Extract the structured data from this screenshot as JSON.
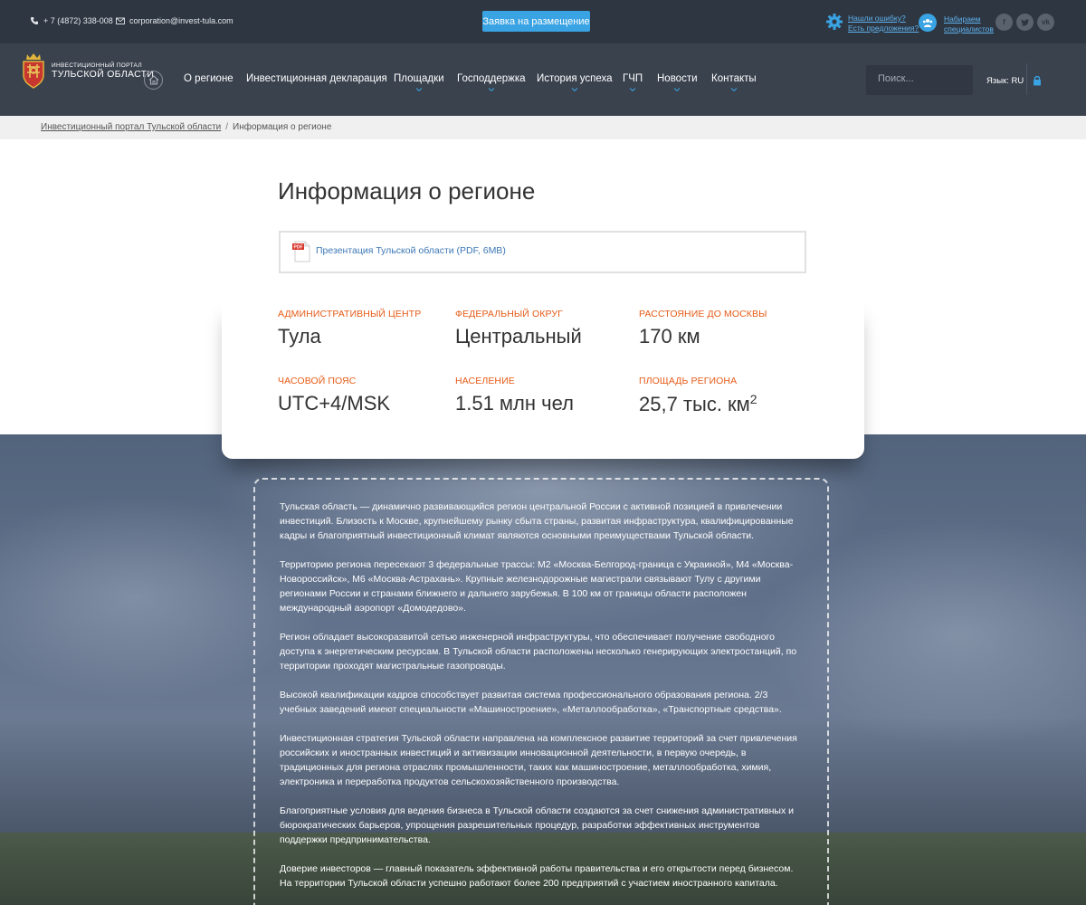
{
  "topbar": {
    "phone": "+ 7 (4872) 338-008",
    "email": "corporation@invest-tula.com",
    "apply_button": "Заявка на размещение",
    "feedback_line1": "Нашли ошибку?",
    "feedback_line2": "Есть предложения?",
    "hiring_line1": "Набираем",
    "hiring_line2": "специалистов",
    "social": [
      "facebook-icon",
      "twitter-icon",
      "vk-icon"
    ]
  },
  "nav": {
    "logo_line1": "ИНВЕСТИЦИОННЫЙ ПОРТАЛ",
    "logo_line2": "ТУЛЬСКОЙ ОБЛАСТИ",
    "items": [
      {
        "label": "О регионе"
      },
      {
        "label": "Инвестиционная декларация"
      },
      {
        "label": "Площадки"
      },
      {
        "label": "Господдержка"
      },
      {
        "label": "История успеха"
      },
      {
        "label": "ГЧП"
      },
      {
        "label": "Новости"
      },
      {
        "label": "Контакты"
      }
    ],
    "search_placeholder": "Поиск...",
    "lang": "Язык: RU"
  },
  "breadcrumb": {
    "home": "Инвестиционный портал Тульской области",
    "current": "Информация о регионе"
  },
  "page": {
    "title": "Информация о регионе",
    "pdf_link": "Презентация Тульской области (PDF, 6MB)"
  },
  "stats": [
    {
      "label": "Административный центр",
      "value": "Тула"
    },
    {
      "label": "Федеральный округ",
      "value": "Центральный"
    },
    {
      "label": "Расстояние до Москвы",
      "value": "170 км"
    },
    {
      "label": "Часовой пояс",
      "value": "UTC+4/MSK"
    },
    {
      "label": "Население",
      "value": "1.51 млн чел"
    },
    {
      "label": "Площадь региона",
      "value": "25,7 тыс. км",
      "sup": "2"
    }
  ],
  "paragraphs": [
    "Тульская область — динамично развивающийся регион центральной России с активной позицией в привлечении инвестиций. Близость к Москве, крупнейшему рынку сбыта страны, развитая инфраструктура, квалифицированные кадры и благоприятный инвестиционный климат являются основными преимуществами Тульской области.",
    "Территорию региона пересекают 3 федеральные трассы: М2 «Москва-Белгород-граница с Украиной», М4 «Москва-Новороссийск», М6 «Москва-Астрахань». Крупные железнодорожные магистрали связывают Тулу с другими регионами России и странами ближнего и дальнего зарубежья. В 100 км от границы области расположен международный аэропорт «Домодедово».",
    "Регион обладает высокоразвитой сетью инженерной инфраструктуры, что обеспечивает получение свободного доступа к энергетическим ресурсам. В Тульской области расположены несколько генерирующих электростанций, по территории проходят магистральные газопроводы.",
    "Высокой квалификации кадров способствует развитая система профессионального образования региона. 2/3 учебных заведений имеют специальности «Машиностроение», «Металлообработка», «Транспортные средства».",
    "Инвестиционная стратегия Тульской области направлена на комплексное развитие территорий за счет привлечения российских и иностранных инвестиций и активизации инновационной деятельности, в первую очередь, в традиционных для региона отраслях промышленности, таких как машиностроение, металлообработка, химия, электроника и переработка продуктов сельскохозяйственного производства.",
    "Благоприятные условия для ведения бизнеса в Тульской области создаются за счет снижения административных и бюрократических барьеров, упрощения разрешительных процедур, разработки эффективных инструментов поддержки предпринимательства.",
    "Доверие инвесторов — главный показатель эффективной работы правительства и его открытости перед бизнесом. На территории Тульской области успешно работают более 200 предприятий с участием иностранного капитала."
  ]
}
